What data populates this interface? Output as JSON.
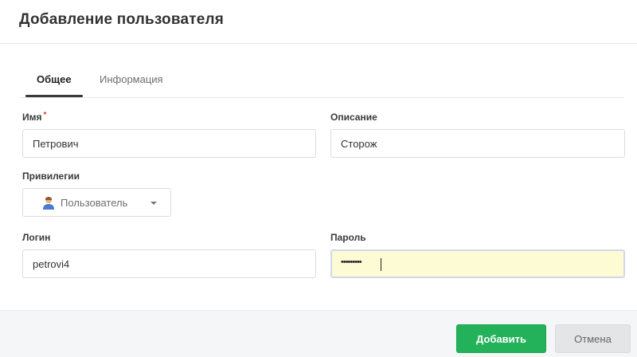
{
  "dialog": {
    "title": "Добавление пользователя"
  },
  "tabs": [
    {
      "label": "Общее",
      "active": true
    },
    {
      "label": "Информация",
      "active": false
    }
  ],
  "form": {
    "name": {
      "label": "Имя",
      "required_mark": "*",
      "value": "Петрович"
    },
    "description": {
      "label": "Описание",
      "value": "Сторож"
    },
    "privileges": {
      "label": "Привилегии",
      "selected": "Пользователь",
      "icon": "user-icon"
    },
    "login": {
      "label": "Логин",
      "value": "petrovi4"
    },
    "password": {
      "label": "Пароль",
      "value": "•••••••••"
    }
  },
  "buttons": {
    "add": "Добавить",
    "cancel": "Отмена"
  },
  "colors": {
    "primary": "#23b25a",
    "required": "#e03a3a",
    "focused_field": "#fcfbd3"
  }
}
